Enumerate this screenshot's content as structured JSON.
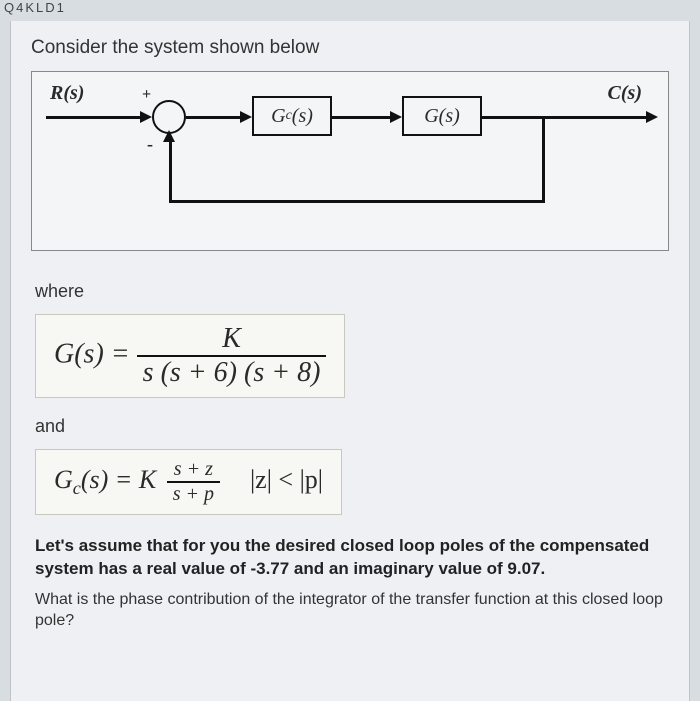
{
  "topLabel": "Q4KLD1",
  "intro": "Consider the system shown below",
  "diagram": {
    "input": "R(s)",
    "output": "C(s)",
    "plus": "+",
    "minus": "-",
    "block1_pre": "G",
    "block1_sub": "c",
    "block1_post": "(s)",
    "block2": "G(s)"
  },
  "where": "where",
  "eq1": {
    "lhs": "G(s) = ",
    "num": "K",
    "den": "s (s + 6) (s + 8)"
  },
  "and": "and",
  "eq2": {
    "lhs_pre": "G",
    "lhs_sub": "c",
    "lhs_post": "(s) = K",
    "frac_num": "s + z",
    "frac_den": "s + p",
    "cond": "   |z| < |p|"
  },
  "assumption": "Let's assume that for you the desired closed loop poles of the compensated system has a real value of  -3.77 and an imaginary value of 9.07.",
  "question": "What is the phase contribution of the integrator of the transfer function at this closed loop pole?"
}
